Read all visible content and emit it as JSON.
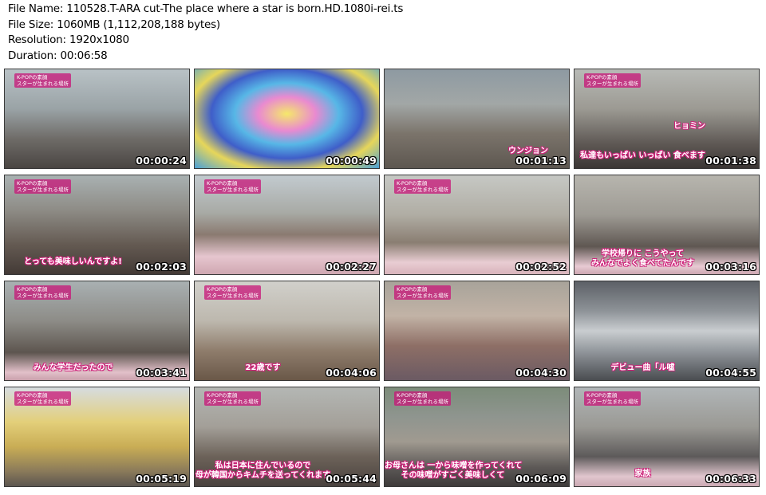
{
  "header": {
    "file_name": "File Name: 110528.T-ARA cut-The place where a star is born.HD.1080i-rei.ts",
    "file_size": "File Size: 1060MB (1,112,208,188 bytes)",
    "resolution": "Resolution: 1920x1080",
    "duration": "Duration: 00:06:58"
  },
  "thumbnails": [
    {
      "timestamp": "00:00:24",
      "caption": "",
      "logo": "K-POPの素顔\nスターが生まれる場所"
    },
    {
      "timestamp": "00:00:49",
      "caption": "",
      "logo": ""
    },
    {
      "timestamp": "00:01:13",
      "caption": "",
      "name_caption": "ウンジョン",
      "logo": ""
    },
    {
      "timestamp": "00:01:38",
      "caption": "私達もいっぱい いっぱい 食べます",
      "name_caption": "ヒョミン",
      "logo": "K-POPの素顔\nスターが生まれる場所"
    },
    {
      "timestamp": "00:02:03",
      "caption": "とっても美味しいんですよ!",
      "logo": "K-POPの素顔\nスターが生まれる場所"
    },
    {
      "timestamp": "00:02:27",
      "caption": "",
      "logo": "K-POPの素顔\nスターが生まれる場所"
    },
    {
      "timestamp": "00:02:52",
      "caption": "",
      "logo": "K-POPの素顔\nスターが生まれる場所"
    },
    {
      "timestamp": "00:03:16",
      "caption": "学校帰りに こうやって\nみんなでよく食べてたんです",
      "logo": ""
    },
    {
      "timestamp": "00:03:41",
      "caption": "みんな学生だったので",
      "logo": "K-POPの素顔\nスターが生まれる場所"
    },
    {
      "timestamp": "00:04:06",
      "caption": "22歳です",
      "logo": "K-POPの素顔\nスターが生まれる場所"
    },
    {
      "timestamp": "00:04:30",
      "caption": "",
      "logo": "K-POPの素顔\nスターが生まれる場所"
    },
    {
      "timestamp": "00:04:55",
      "caption": "デビュー曲「ル嘘",
      "logo": ""
    },
    {
      "timestamp": "00:05:19",
      "caption": "",
      "logo": "K-POPの素顔\nスターが生まれる場所"
    },
    {
      "timestamp": "00:05:44",
      "caption": "私は日本に住んでいるので\n母が韓国からキムチを送ってくれます",
      "logo": "K-POPの素顔\nスターが生まれる場所"
    },
    {
      "timestamp": "00:06:09",
      "caption": "お母さんは 一から味噌を作ってくれて\nその味噌がすごく美味しくて",
      "logo": "K-POPの素顔\nスターが生まれる場所"
    },
    {
      "timestamp": "00:06:33",
      "caption": "家族",
      "logo": "K-POPの素顔\nスターが生まれる場所"
    }
  ]
}
